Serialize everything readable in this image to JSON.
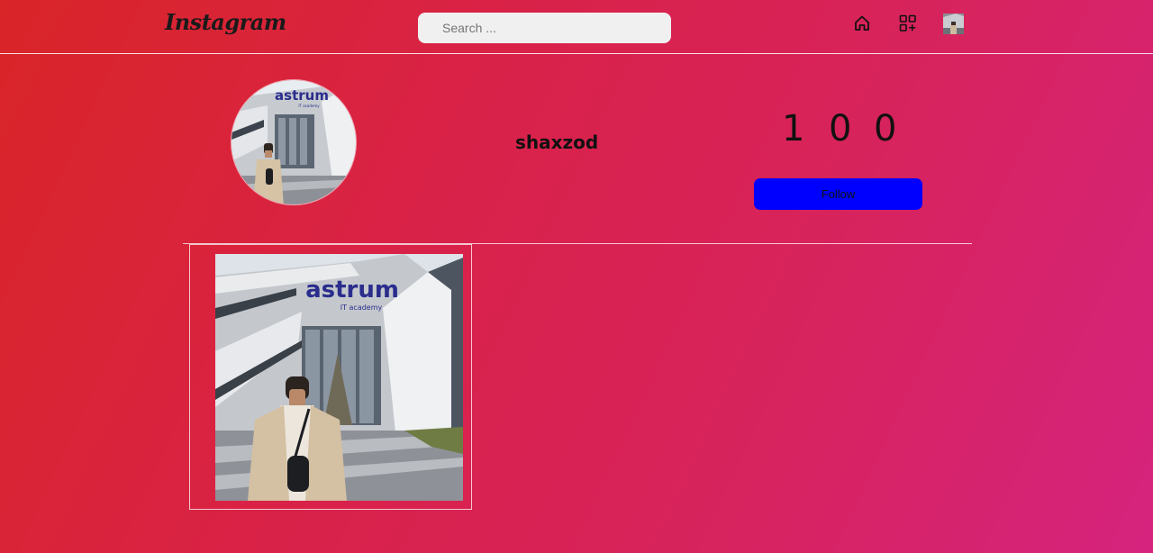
{
  "header": {
    "logo": "Instagram",
    "search_placeholder": "Search ...",
    "icons": [
      "home-icon",
      "add-apps-icon",
      "avatar"
    ]
  },
  "profile": {
    "username": "shaxzod",
    "stats": [
      "1",
      "0",
      "0"
    ],
    "follow_label": "Follow"
  },
  "photo": {
    "sign_text": "astrum",
    "sign_subtext": "IT academy"
  },
  "colors": {
    "gradient_start": "#d92528",
    "gradient_end": "#d6237e",
    "follow_button": "#0000ff",
    "search_bg": "#f0f0f0"
  }
}
